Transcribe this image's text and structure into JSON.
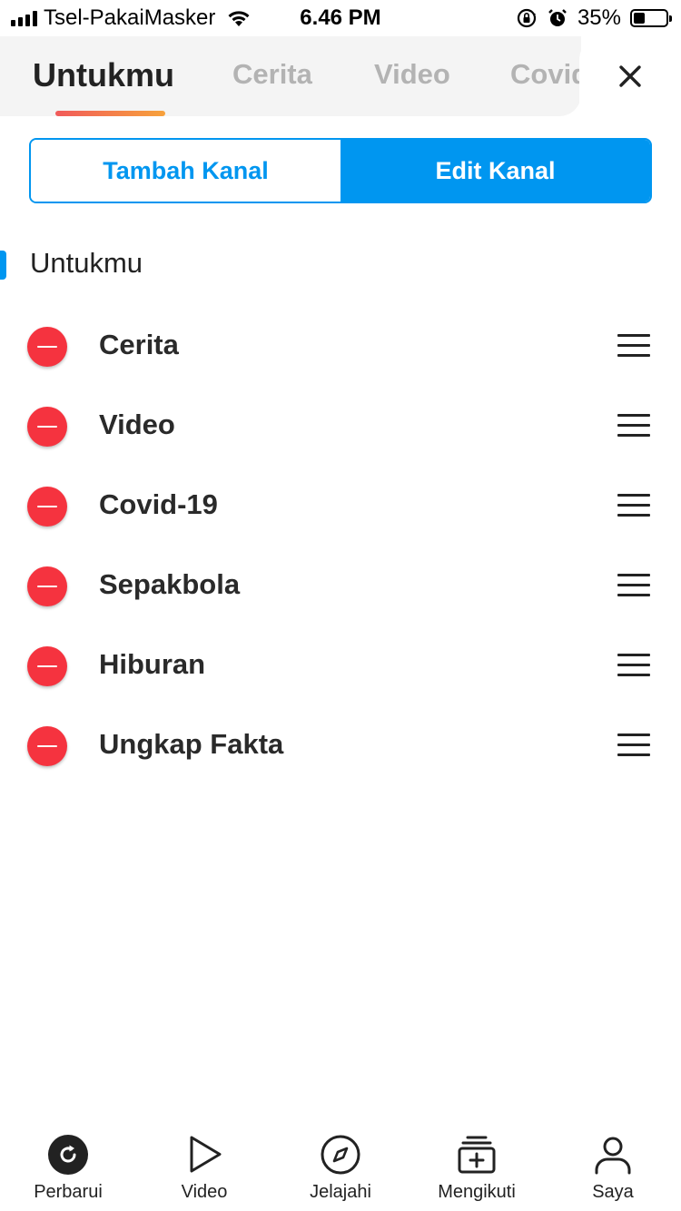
{
  "status_bar": {
    "carrier": "Tsel-PakaiMasker",
    "time": "6.46 PM",
    "battery_percent": "35%",
    "battery_level": 0.35
  },
  "tabs": [
    {
      "label": "Untukmu",
      "active": true
    },
    {
      "label": "Cerita",
      "active": false
    },
    {
      "label": "Video",
      "active": false
    },
    {
      "label": "Covid",
      "active": false
    }
  ],
  "segmented": {
    "add_label": "Tambah Kanal",
    "edit_label": "Edit Kanal",
    "selected": "edit"
  },
  "section": {
    "title": "Untukmu"
  },
  "channels": [
    {
      "label": "Cerita"
    },
    {
      "label": "Video"
    },
    {
      "label": "Covid-19"
    },
    {
      "label": "Sepakbola"
    },
    {
      "label": "Hiburan"
    },
    {
      "label": "Ungkap Fakta"
    }
  ],
  "bottom_nav": [
    {
      "label": "Perbarui",
      "icon": "refresh-icon"
    },
    {
      "label": "Video",
      "icon": "play-icon"
    },
    {
      "label": "Jelajahi",
      "icon": "compass-icon"
    },
    {
      "label": "Mengikuti",
      "icon": "following-icon"
    },
    {
      "label": "Saya",
      "icon": "profile-icon"
    }
  ],
  "colors": {
    "accent": "#0096f0",
    "remove": "#f5333f",
    "tab_indicator_start": "#f15a5a",
    "tab_indicator_end": "#f7a23b"
  }
}
